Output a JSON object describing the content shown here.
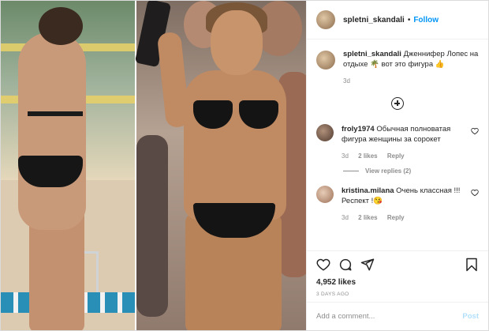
{
  "header": {
    "username": "spletni_skandali",
    "separator": "•",
    "follow_label": "Follow"
  },
  "caption": {
    "username": "spletni_skandali",
    "text": "Дженнифер Лопес на отдыхе 🌴 вот это фигура 👍",
    "time": "3d"
  },
  "comments": [
    {
      "username": "froly1974",
      "text": "Обычная полноватая фигура женщины за сорокет",
      "time": "3d",
      "likes": "2 likes",
      "reply_label": "Reply",
      "view_replies": "View replies (2)"
    },
    {
      "username": "kristina.milana",
      "text": "Очень классная !!! Респект !😘",
      "time": "3d",
      "likes": "2 likes",
      "reply_label": "Reply"
    }
  ],
  "actions": {
    "likes": "4,952 likes",
    "date": "3 DAYS AGO"
  },
  "add_comment": {
    "placeholder": "Add a comment...",
    "post_label": "Post"
  },
  "colors": {
    "follow_blue": "#0095f6",
    "post_disabled": "#b2dffc",
    "muted_text": "#8e8e8e"
  },
  "icons": [
    "heart-icon",
    "comment-icon",
    "share-icon",
    "bookmark-icon",
    "plus-circle-icon"
  ]
}
